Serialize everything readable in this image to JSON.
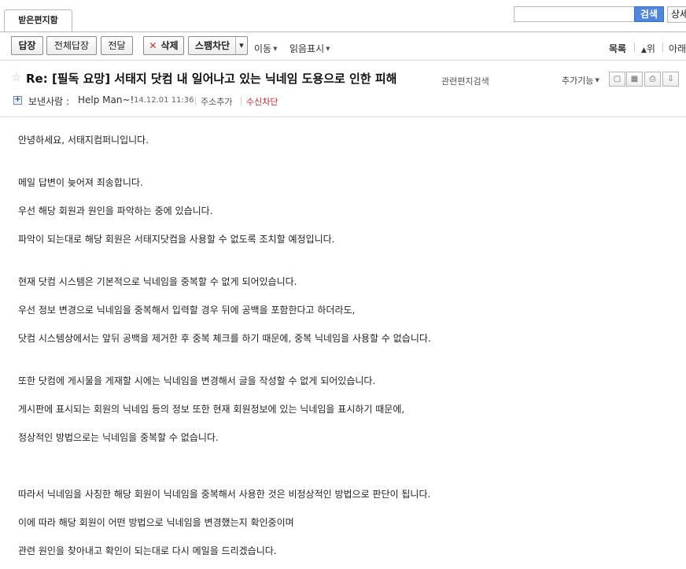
{
  "tab": {
    "label": "받은편지함"
  },
  "search": {
    "placeholder": "",
    "button_label": "검색",
    "detail_label": "상세"
  },
  "toolbar": {
    "reply": "답장",
    "reply_all": "전체답장",
    "forward": "전달",
    "delete": "삭제",
    "spam_block": "스팸차단",
    "move": "이동",
    "read_mark": "읽음표시",
    "list": "목록",
    "up": "위",
    "down": "아래"
  },
  "message": {
    "subject": "Re: [필독 요망] 서태지 닷컴 내 일어나고 있는 닉네임 도용으로 인한 피해",
    "related_search": "관련편지검색",
    "extra_functions": "추가기능",
    "sender_label": "보낸사람 :",
    "sender_name": "Help Man~!",
    "date": "14.12.01 11:36",
    "add_address": "주소추가",
    "block_receive": "수신차단",
    "body": [
      "안녕하세요, 서태지컴퍼니입니다.",
      "메일 답변이 늦어져 죄송합니다.",
      "우선 해당 회원과 원인을 파악하는 중에 있습니다.",
      "파악이 되는대로 해당 회원은 서태지닷컴을 사용할 수 없도록 조치할 예정입니다.",
      "현재 닷컴 시스템은 기본적으로 닉네임을 중복할 수 없게 되어있습니다.",
      "우선 정보 변경으로 닉네임을 중복해서 입력할 경우 뒤에 공백을 포함한다고 하더라도,",
      "닷컴 시스템상에서는 앞뒤 공백을 제거한 후 중복 체크를 하기 때문에, 중복 닉네임을 사용할 수 없습니다.",
      "또한 닷컴에 게시물을 게재할 시에는 닉네임을 변경해서 글을 작성할 수 없게 되어있습니다.",
      "게시판에 표시되는 회원의 닉네임 등의 정보 또한 현재 회원정보에 있는 닉네임을 표시하기 때문에,",
      "정상적인 방법으로는 닉네임을 중복할 수 없습니다.",
      "따라서 닉네임을 사칭한 해당 회원이 닉네임을 중복해서 사용한 것은 비정상적인 방법으로 판단이 됩니다.",
      "이에 따라 해당 회원이 어떤 방법으로 닉네임을 변경했는지 확인중이며",
      "관련 원인을 찾아내고 확인이 되는대로 다시 메일을 드리겠습니다."
    ]
  },
  "icons": {
    "star": "star-icon",
    "delete": "x-icon",
    "add_sender": "plus-icon",
    "caret": "caret-down-icon",
    "up_arrow": "arrow-up-icon",
    "view_icons": [
      "single-view-icon",
      "calendar-icon",
      "print-icon",
      "save-icon"
    ]
  },
  "colors": {
    "search_button": "#4f86e0",
    "delete_x": "#d0312d",
    "block_text": "#d02020"
  }
}
